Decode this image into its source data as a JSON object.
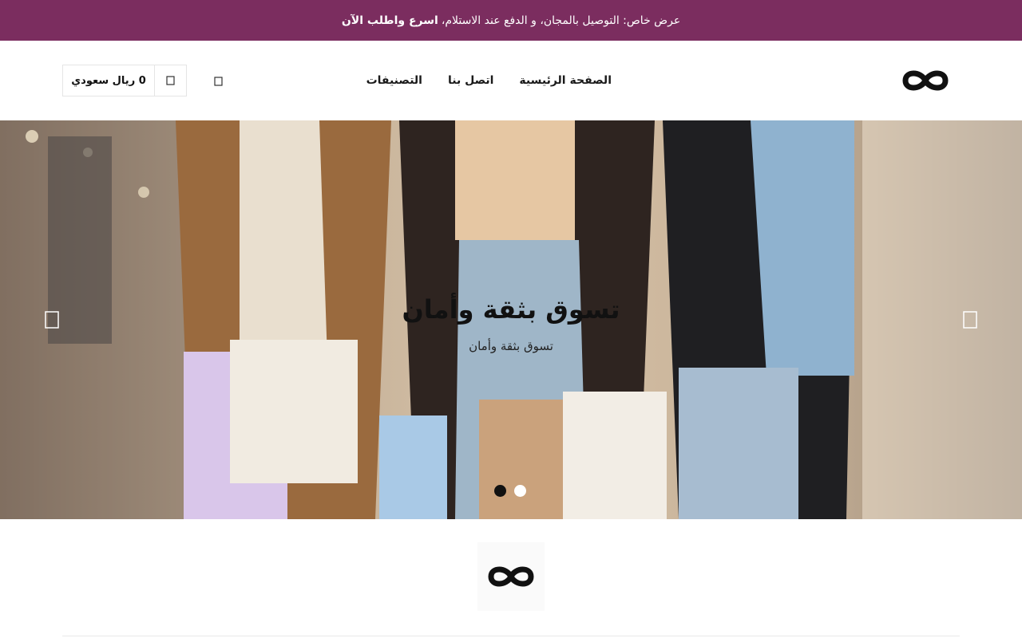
{
  "promo": {
    "text": "عرض خاص: التوصيل بالمجان، و الدفع عند الاستلام،",
    "highlight": "اسرع واطلب الآن"
  },
  "nav": {
    "items": [
      {
        "label": "الصفحة الرئيسية"
      },
      {
        "label": "اتصل بنا"
      },
      {
        "label": "التصنيفات"
      }
    ]
  },
  "cart": {
    "amount": "0 ريال سعودي",
    "icon": "shopping-bag-icon"
  },
  "search": {
    "icon": "search-icon"
  },
  "hero": {
    "title": "تسوق بثقة وأمان",
    "subtitle": "تسوق بثقة وأمان",
    "prev_icon": "chevron-left-icon",
    "next_icon": "chevron-right-icon",
    "slides_count": 2,
    "active_slide": 2
  },
  "colors": {
    "promo_bg": "#7b2d5f",
    "logo": "#111111"
  }
}
